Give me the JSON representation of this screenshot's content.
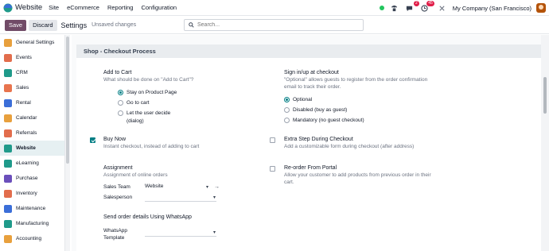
{
  "navbar": {
    "app_name": "Website",
    "menu": [
      "Site",
      "eCommerce",
      "Reporting",
      "Configuration"
    ],
    "messages_badge": "2",
    "activity_badge": "45",
    "company": "My Company (San Francisco)"
  },
  "control": {
    "save_label": "Save",
    "discard_label": "Discard",
    "title": "Settings",
    "unsaved": "Unsaved changes",
    "search_placeholder": "Search..."
  },
  "sidebar": {
    "items": [
      {
        "label": "General Settings",
        "icon": "gear-icon",
        "color": "#e8a03d"
      },
      {
        "label": "Events",
        "icon": "events-icon",
        "color": "#e26d4c"
      },
      {
        "label": "CRM",
        "icon": "crm-icon",
        "color": "#1f9a8a"
      },
      {
        "label": "Sales",
        "icon": "sales-icon",
        "color": "#e8744e"
      },
      {
        "label": "Rental",
        "icon": "rental-icon",
        "color": "#3b6ed8"
      },
      {
        "label": "Calendar",
        "icon": "calendar-icon",
        "color": "#e8a03d"
      },
      {
        "label": "Referrals",
        "icon": "referrals-icon",
        "color": "#e26d4c"
      },
      {
        "label": "Website",
        "icon": "website-icon",
        "color": "#1f9a8a"
      },
      {
        "label": "eLearning",
        "icon": "elearning-icon",
        "color": "#1f9a8a"
      },
      {
        "label": "Purchase",
        "icon": "purchase-icon",
        "color": "#6b4fbb"
      },
      {
        "label": "Inventory",
        "icon": "inventory-icon",
        "color": "#e26d4c"
      },
      {
        "label": "Maintenance",
        "icon": "maintenance-icon",
        "color": "#3b6ed8"
      },
      {
        "label": "Manufacturing",
        "icon": "manufacturing-icon",
        "color": "#1f9a8a"
      },
      {
        "label": "Accounting",
        "icon": "accounting-icon",
        "color": "#e8a03d"
      }
    ],
    "active": "Website"
  },
  "section": {
    "title": "Shop - Checkout Process"
  },
  "settings": {
    "add_to_cart": {
      "title": "Add to Cart",
      "desc": "What should be done on \"Add to Cart\"?",
      "options": [
        "Stay on Product Page",
        "Go to cart",
        "Let the user decide",
        "(dialog)"
      ],
      "selected": "Stay on Product Page"
    },
    "sign_in": {
      "title": "Sign in/up at checkout",
      "desc1": "\"Optional\" allows guests to register from the order confirmation",
      "desc2": "email to track their order.",
      "options": [
        "Optional",
        "Disabled (buy as guest)",
        "Mandatory (no guest checkout)"
      ],
      "selected": "Optional"
    },
    "buy_now": {
      "title": "Buy Now",
      "desc": "Instant checkout, instead of adding to cart",
      "checked": true
    },
    "extra_step": {
      "title": "Extra Step During Checkout",
      "desc": "Add a customizable form during checkout (after address)",
      "checked": false
    },
    "assignment": {
      "title": "Assignment",
      "desc": "Assignment of online orders",
      "sales_team_label": "Sales Team",
      "sales_team_value": "Website",
      "salesperson_label": "Salesperson",
      "salesperson_value": ""
    },
    "reorder": {
      "title": "Re-order From Portal",
      "desc1": "Allow your customer to add products from previous order in their",
      "desc2": "cart.",
      "checked": false
    },
    "whatsapp": {
      "title": "Send order details Using WhatsApp",
      "label1": "WhatsApp",
      "label2": "Template",
      "value": ""
    }
  }
}
